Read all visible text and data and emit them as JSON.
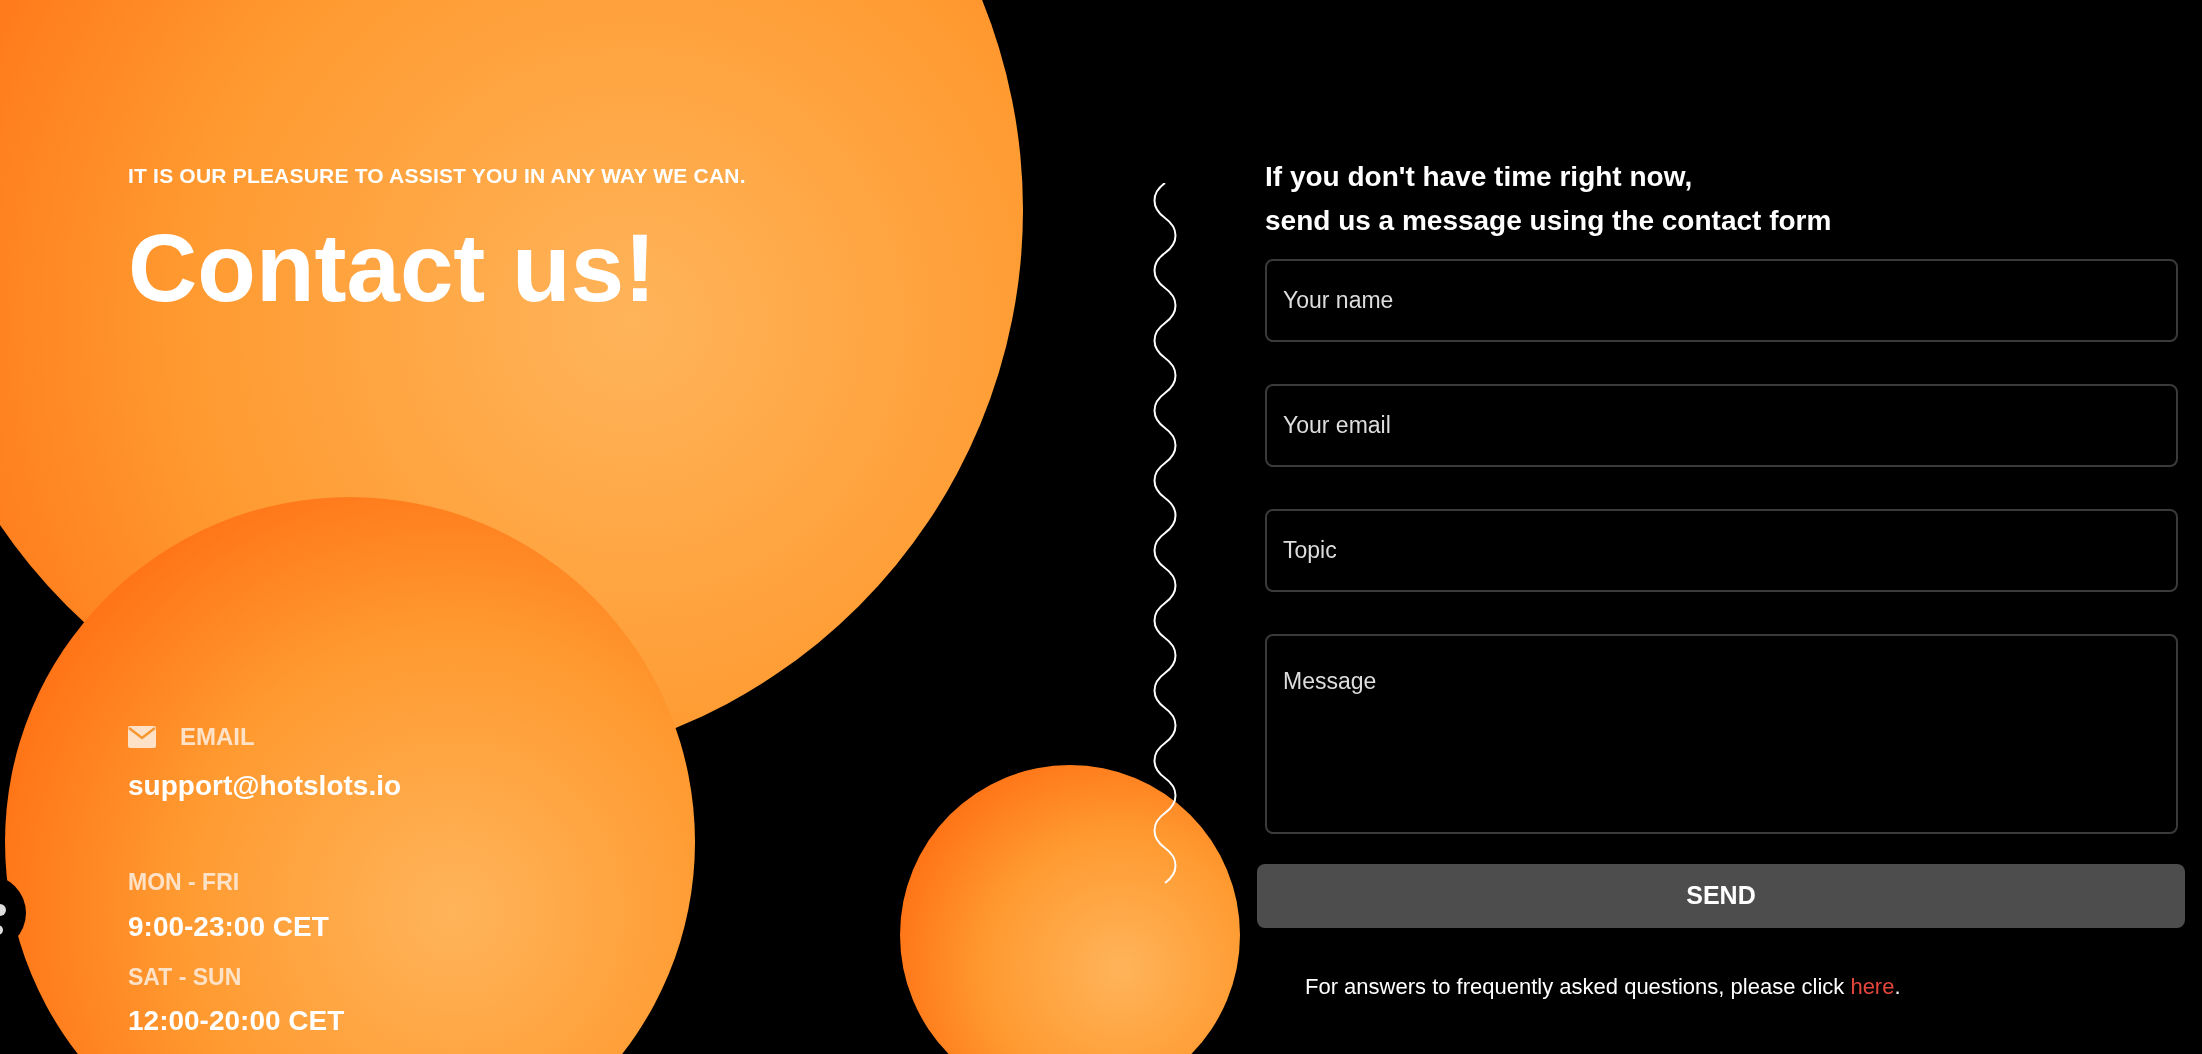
{
  "intro": {
    "tagline": "IT IS OUR PLEASURE TO ASSIST YOU IN ANY WAY WE CAN.",
    "title": "Contact us!"
  },
  "email": {
    "label": "EMAIL",
    "value": "support@hotslots.io"
  },
  "hours": [
    {
      "days": "MON - FRI",
      "time": "9:00-23:00 CET"
    },
    {
      "days": "SAT - SUN",
      "time": "12:00-20:00 CET"
    }
  ],
  "form": {
    "heading": [
      "If you don't have time right now,",
      "send us a message using the contact form"
    ],
    "fields": [
      {
        "kind": "input",
        "placeholder": "Your name"
      },
      {
        "kind": "input",
        "placeholder": "Your email"
      },
      {
        "kind": "input",
        "placeholder": "Topic"
      },
      {
        "kind": "textarea",
        "placeholder": "Message"
      }
    ],
    "submit": "SEND",
    "faq_note": {
      "text": "For answers to frequently asked questions, please click",
      "link": "here",
      "suffix": "."
    }
  }
}
